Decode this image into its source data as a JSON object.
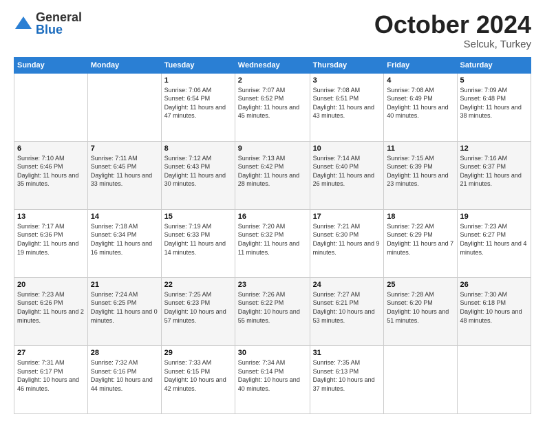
{
  "logo": {
    "general": "General",
    "blue": "Blue"
  },
  "title": "October 2024",
  "subtitle": "Selcuk, Turkey",
  "days_header": [
    "Sunday",
    "Monday",
    "Tuesday",
    "Wednesday",
    "Thursday",
    "Friday",
    "Saturday"
  ],
  "weeks": [
    [
      {
        "day": "",
        "sunrise": "",
        "sunset": "",
        "daylight": ""
      },
      {
        "day": "",
        "sunrise": "",
        "sunset": "",
        "daylight": ""
      },
      {
        "day": "1",
        "sunrise": "Sunrise: 7:06 AM",
        "sunset": "Sunset: 6:54 PM",
        "daylight": "Daylight: 11 hours and 47 minutes."
      },
      {
        "day": "2",
        "sunrise": "Sunrise: 7:07 AM",
        "sunset": "Sunset: 6:52 PM",
        "daylight": "Daylight: 11 hours and 45 minutes."
      },
      {
        "day": "3",
        "sunrise": "Sunrise: 7:08 AM",
        "sunset": "Sunset: 6:51 PM",
        "daylight": "Daylight: 11 hours and 43 minutes."
      },
      {
        "day": "4",
        "sunrise": "Sunrise: 7:08 AM",
        "sunset": "Sunset: 6:49 PM",
        "daylight": "Daylight: 11 hours and 40 minutes."
      },
      {
        "day": "5",
        "sunrise": "Sunrise: 7:09 AM",
        "sunset": "Sunset: 6:48 PM",
        "daylight": "Daylight: 11 hours and 38 minutes."
      }
    ],
    [
      {
        "day": "6",
        "sunrise": "Sunrise: 7:10 AM",
        "sunset": "Sunset: 6:46 PM",
        "daylight": "Daylight: 11 hours and 35 minutes."
      },
      {
        "day": "7",
        "sunrise": "Sunrise: 7:11 AM",
        "sunset": "Sunset: 6:45 PM",
        "daylight": "Daylight: 11 hours and 33 minutes."
      },
      {
        "day": "8",
        "sunrise": "Sunrise: 7:12 AM",
        "sunset": "Sunset: 6:43 PM",
        "daylight": "Daylight: 11 hours and 30 minutes."
      },
      {
        "day": "9",
        "sunrise": "Sunrise: 7:13 AM",
        "sunset": "Sunset: 6:42 PM",
        "daylight": "Daylight: 11 hours and 28 minutes."
      },
      {
        "day": "10",
        "sunrise": "Sunrise: 7:14 AM",
        "sunset": "Sunset: 6:40 PM",
        "daylight": "Daylight: 11 hours and 26 minutes."
      },
      {
        "day": "11",
        "sunrise": "Sunrise: 7:15 AM",
        "sunset": "Sunset: 6:39 PM",
        "daylight": "Daylight: 11 hours and 23 minutes."
      },
      {
        "day": "12",
        "sunrise": "Sunrise: 7:16 AM",
        "sunset": "Sunset: 6:37 PM",
        "daylight": "Daylight: 11 hours and 21 minutes."
      }
    ],
    [
      {
        "day": "13",
        "sunrise": "Sunrise: 7:17 AM",
        "sunset": "Sunset: 6:36 PM",
        "daylight": "Daylight: 11 hours and 19 minutes."
      },
      {
        "day": "14",
        "sunrise": "Sunrise: 7:18 AM",
        "sunset": "Sunset: 6:34 PM",
        "daylight": "Daylight: 11 hours and 16 minutes."
      },
      {
        "day": "15",
        "sunrise": "Sunrise: 7:19 AM",
        "sunset": "Sunset: 6:33 PM",
        "daylight": "Daylight: 11 hours and 14 minutes."
      },
      {
        "day": "16",
        "sunrise": "Sunrise: 7:20 AM",
        "sunset": "Sunset: 6:32 PM",
        "daylight": "Daylight: 11 hours and 11 minutes."
      },
      {
        "day": "17",
        "sunrise": "Sunrise: 7:21 AM",
        "sunset": "Sunset: 6:30 PM",
        "daylight": "Daylight: 11 hours and 9 minutes."
      },
      {
        "day": "18",
        "sunrise": "Sunrise: 7:22 AM",
        "sunset": "Sunset: 6:29 PM",
        "daylight": "Daylight: 11 hours and 7 minutes."
      },
      {
        "day": "19",
        "sunrise": "Sunrise: 7:23 AM",
        "sunset": "Sunset: 6:27 PM",
        "daylight": "Daylight: 11 hours and 4 minutes."
      }
    ],
    [
      {
        "day": "20",
        "sunrise": "Sunrise: 7:23 AM",
        "sunset": "Sunset: 6:26 PM",
        "daylight": "Daylight: 11 hours and 2 minutes."
      },
      {
        "day": "21",
        "sunrise": "Sunrise: 7:24 AM",
        "sunset": "Sunset: 6:25 PM",
        "daylight": "Daylight: 11 hours and 0 minutes."
      },
      {
        "day": "22",
        "sunrise": "Sunrise: 7:25 AM",
        "sunset": "Sunset: 6:23 PM",
        "daylight": "Daylight: 10 hours and 57 minutes."
      },
      {
        "day": "23",
        "sunrise": "Sunrise: 7:26 AM",
        "sunset": "Sunset: 6:22 PM",
        "daylight": "Daylight: 10 hours and 55 minutes."
      },
      {
        "day": "24",
        "sunrise": "Sunrise: 7:27 AM",
        "sunset": "Sunset: 6:21 PM",
        "daylight": "Daylight: 10 hours and 53 minutes."
      },
      {
        "day": "25",
        "sunrise": "Sunrise: 7:28 AM",
        "sunset": "Sunset: 6:20 PM",
        "daylight": "Daylight: 10 hours and 51 minutes."
      },
      {
        "day": "26",
        "sunrise": "Sunrise: 7:30 AM",
        "sunset": "Sunset: 6:18 PM",
        "daylight": "Daylight: 10 hours and 48 minutes."
      }
    ],
    [
      {
        "day": "27",
        "sunrise": "Sunrise: 7:31 AM",
        "sunset": "Sunset: 6:17 PM",
        "daylight": "Daylight: 10 hours and 46 minutes."
      },
      {
        "day": "28",
        "sunrise": "Sunrise: 7:32 AM",
        "sunset": "Sunset: 6:16 PM",
        "daylight": "Daylight: 10 hours and 44 minutes."
      },
      {
        "day": "29",
        "sunrise": "Sunrise: 7:33 AM",
        "sunset": "Sunset: 6:15 PM",
        "daylight": "Daylight: 10 hours and 42 minutes."
      },
      {
        "day": "30",
        "sunrise": "Sunrise: 7:34 AM",
        "sunset": "Sunset: 6:14 PM",
        "daylight": "Daylight: 10 hours and 40 minutes."
      },
      {
        "day": "31",
        "sunrise": "Sunrise: 7:35 AM",
        "sunset": "Sunset: 6:13 PM",
        "daylight": "Daylight: 10 hours and 37 minutes."
      },
      {
        "day": "",
        "sunrise": "",
        "sunset": "",
        "daylight": ""
      },
      {
        "day": "",
        "sunrise": "",
        "sunset": "",
        "daylight": ""
      }
    ]
  ]
}
